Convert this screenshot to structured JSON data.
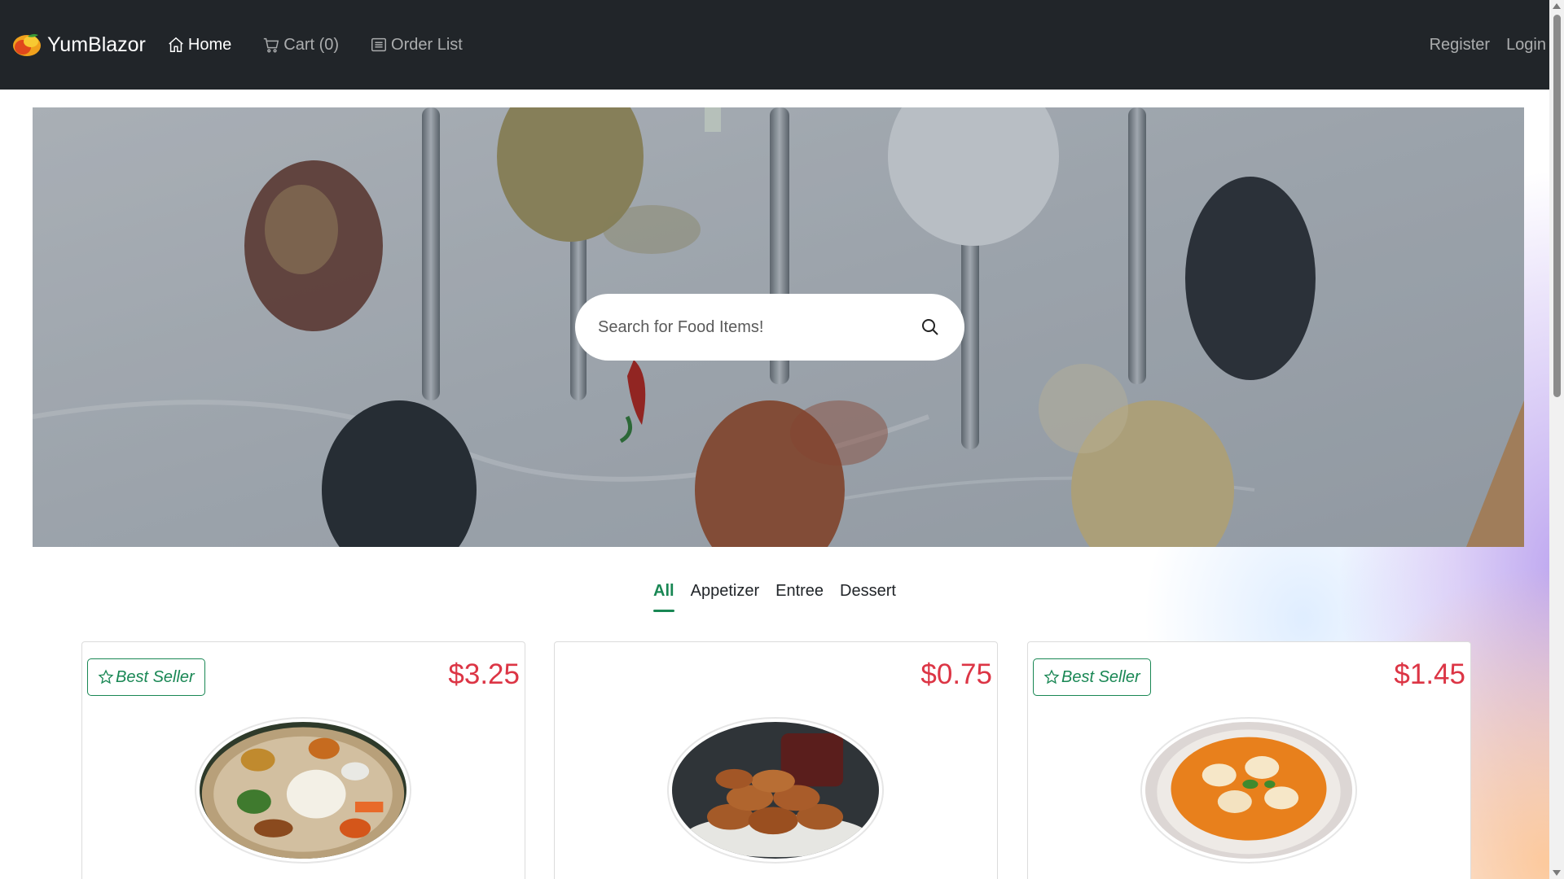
{
  "brand": {
    "name": "YumBlazor",
    "logo_icon": "mango-logo-icon"
  },
  "nav": {
    "home": "Home",
    "cart": "Cart (0)",
    "order_list": "Order List",
    "register": "Register",
    "login": "Login"
  },
  "search": {
    "placeholder": "Search for Food Items!",
    "value": ""
  },
  "categories": [
    {
      "label": "All",
      "active": true
    },
    {
      "label": "Appetizer",
      "active": false
    },
    {
      "label": "Entree",
      "active": false
    },
    {
      "label": "Dessert",
      "active": false
    }
  ],
  "products": [
    {
      "badge": "Best Seller",
      "price": "$3.25",
      "image": "thali-plate-image"
    },
    {
      "badge": "",
      "price": "$0.75",
      "image": "fried-patties-image"
    },
    {
      "badge": "Best Seller",
      "price": "$1.45",
      "image": "momo-soup-image"
    }
  ],
  "colors": {
    "navbar": "#212529",
    "accent": "#198754",
    "price": "#dc3545"
  }
}
